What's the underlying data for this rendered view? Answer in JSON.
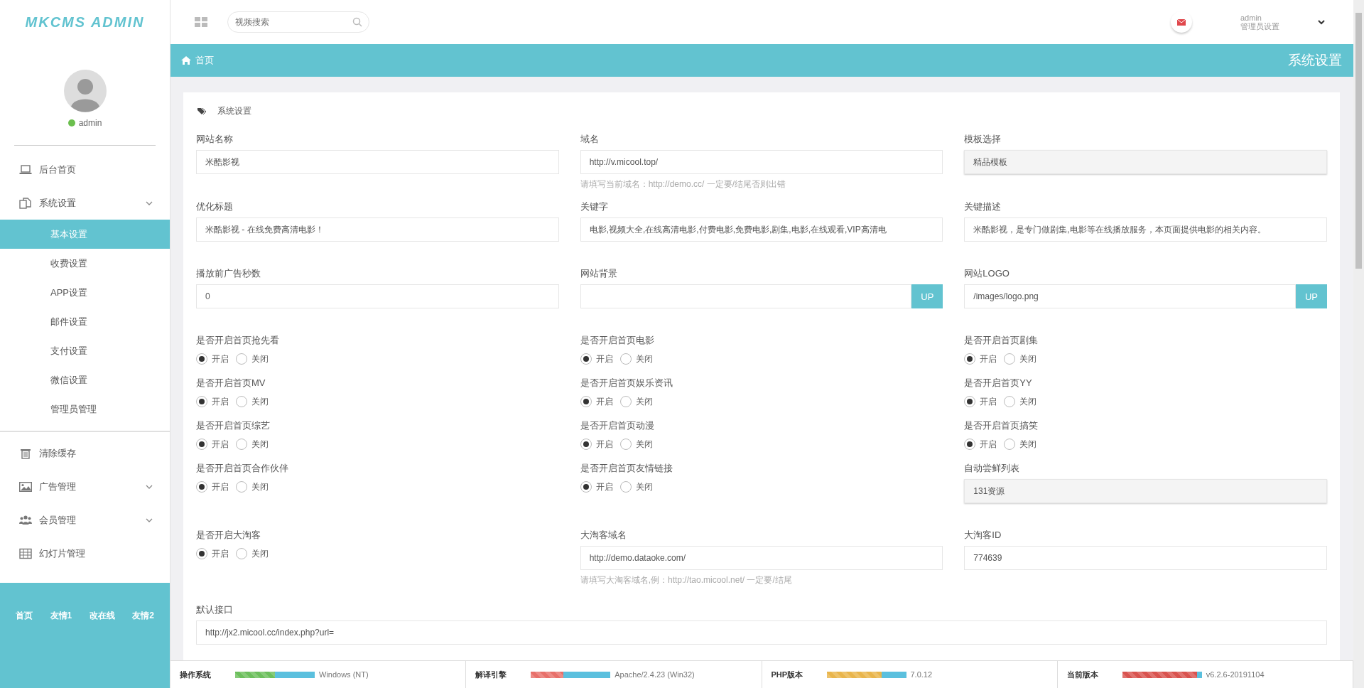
{
  "sidebar": {
    "logo": "MKCMS ADMIN",
    "user": {
      "name": "admin",
      "online": true
    },
    "menu": [
      {
        "label": "后台首页",
        "kind": "link"
      },
      {
        "label": "系统设置",
        "kind": "group",
        "children": [
          {
            "label": "基本设置",
            "selected": true
          },
          {
            "label": "收费设置",
            "selected": false
          },
          {
            "label": "APP设置",
            "selected": false
          },
          {
            "label": "邮件设置",
            "selected": false
          },
          {
            "label": "支付设置",
            "selected": false
          },
          {
            "label": "微信设置",
            "selected": false
          },
          {
            "label": "管理员管理",
            "selected": false
          }
        ]
      },
      {
        "label": "清除缓存",
        "kind": "link"
      },
      {
        "label": "广告管理",
        "kind": "group"
      },
      {
        "label": "会员管理",
        "kind": "group"
      },
      {
        "label": "幻灯片管理",
        "kind": "link"
      }
    ],
    "footer_links": [
      "首页",
      "友情1",
      "改在线",
      "友情2"
    ]
  },
  "topbar": {
    "search": {
      "placeholder": "视频搜索"
    },
    "user": {
      "name": "admin",
      "role": "管理员设置"
    }
  },
  "breadcrumb": {
    "home": "首页",
    "page_title": "系统设置"
  },
  "panel": {
    "title": "系统设置",
    "fields": [
      {
        "kind": "text",
        "label": "网站名称",
        "value": "米酷影视"
      },
      {
        "kind": "text",
        "label": "域名",
        "value": "http://v.micool.top/",
        "hint": "请填写当前域名：http://demo.cc/ 一定要/结尾否则出错"
      },
      {
        "kind": "readonly",
        "label": "模板选择",
        "value": "精品模板"
      },
      {
        "kind": "text",
        "label": "优化标题",
        "value": "米酷影视 - 在线免费高清电影！"
      },
      {
        "kind": "text",
        "label": "关键字",
        "value": "电影,视频大全,在线高清电影,付费电影,免费电影,剧集,电影,在线观看,VIP高清电"
      },
      {
        "kind": "text",
        "label": "关键描述",
        "value": "米酷影视，是专门做剧集,电影等在线播放服务，本页面提供电影的相关内容。"
      },
      {
        "kind": "text",
        "label": "播放前广告秒数",
        "value": "0"
      },
      {
        "kind": "upload",
        "label": "网站背景",
        "button": "UP"
      },
      {
        "kind": "upload",
        "label": "网站LOGO",
        "value": "/images/logo.png",
        "button": "UP"
      },
      {
        "kind": "radio",
        "label": "是否开启首页抢先看",
        "options": [
          {
            "label": "开启",
            "selected": true
          },
          {
            "label": "关闭",
            "selected": false
          }
        ]
      },
      {
        "kind": "radio",
        "label": "是否开启首页电影",
        "options": [
          {
            "label": "开启",
            "selected": true
          },
          {
            "label": "关闭",
            "selected": false
          }
        ]
      },
      {
        "kind": "radio",
        "label": "是否开启首页剧集",
        "options": [
          {
            "label": "开启",
            "selected": true
          },
          {
            "label": "关闭",
            "selected": false
          }
        ]
      },
      {
        "kind": "radio",
        "label": "是否开启首页MV",
        "options": [
          {
            "label": "开启",
            "selected": true
          },
          {
            "label": "关闭",
            "selected": false
          }
        ]
      },
      {
        "kind": "radio",
        "label": "是否开启首页娱乐资讯",
        "options": [
          {
            "label": "开启",
            "selected": true
          },
          {
            "label": "关闭",
            "selected": false
          }
        ]
      },
      {
        "kind": "radio",
        "label": "是否开启首页YY",
        "options": [
          {
            "label": "开启",
            "selected": true
          },
          {
            "label": "关闭",
            "selected": false
          }
        ]
      },
      {
        "kind": "radio",
        "label": "是否开启首页综艺",
        "options": [
          {
            "label": "开启",
            "selected": true
          },
          {
            "label": "关闭",
            "selected": false
          }
        ]
      },
      {
        "kind": "radio",
        "label": "是否开启首页动漫",
        "options": [
          {
            "label": "开启",
            "selected": true
          },
          {
            "label": "关闭",
            "selected": false
          }
        ]
      },
      {
        "kind": "radio",
        "label": "是否开启首页搞笑",
        "options": [
          {
            "label": "开启",
            "selected": true
          },
          {
            "label": "关闭",
            "selected": false
          }
        ]
      },
      {
        "kind": "radio",
        "label": "是否开启首页合作伙伴",
        "options": [
          {
            "label": "开启",
            "selected": true
          },
          {
            "label": "关闭",
            "selected": false
          }
        ]
      },
      {
        "kind": "radio",
        "label": "是否开启首页友情链接",
        "options": [
          {
            "label": "开启",
            "selected": true
          },
          {
            "label": "关闭",
            "selected": false
          }
        ]
      },
      {
        "kind": "readonly",
        "label": "自动尝鲜列表",
        "value": "131资源"
      },
      {
        "kind": "radio",
        "label": "是否开启大淘客",
        "options": [
          {
            "label": "开启",
            "selected": true
          },
          {
            "label": "关闭",
            "selected": false
          }
        ]
      },
      {
        "kind": "text",
        "label": "大淘客域名",
        "value": "http://demo.dataoke.com/",
        "hint": "请填写大淘客域名,例：http://tao.micool.net/ 一定要/结尾"
      },
      {
        "kind": "text",
        "label": "大淘客ID",
        "value": "774639"
      },
      {
        "kind": "wide",
        "label": "默认接口",
        "value": "http://jx2.micool.cc/index.php?url="
      }
    ]
  },
  "status_bar": [
    {
      "label": "操作系统",
      "level": 0.5,
      "color": "#6cbf5c",
      "value": "Windows (NT)"
    },
    {
      "label": "解译引擎",
      "level": 0.41,
      "color": "#e8706a",
      "value": "Apache/2.4.23 (Win32)"
    },
    {
      "label": "PHP版本",
      "level": 0.69,
      "color": "#e9b54b",
      "value": "7.0.12"
    },
    {
      "label": "当前版本",
      "level": 0.94,
      "color": "#d9534f",
      "value": "v6.2.6-20191104"
    }
  ]
}
